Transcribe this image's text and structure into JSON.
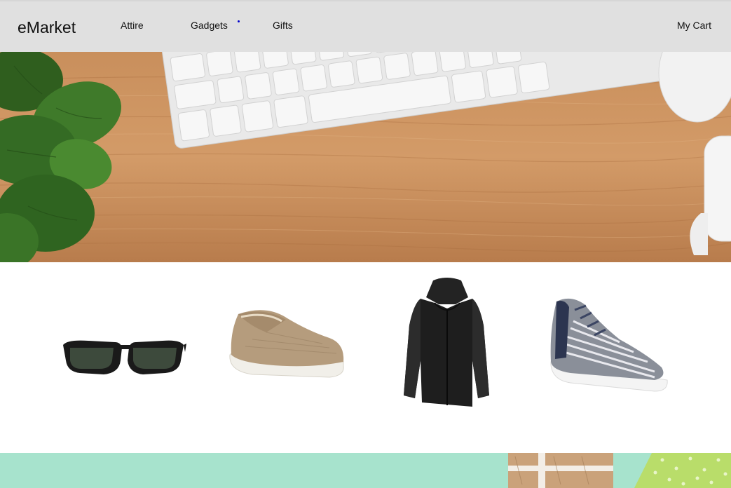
{
  "brand": {
    "name": "eMarket"
  },
  "nav": {
    "items": [
      {
        "label": "Attire"
      },
      {
        "label": "Gadgets"
      },
      {
        "label": "Gifts"
      }
    ],
    "cart_label": "My Cart"
  },
  "hero": {
    "scene": "desk-with-keyboard-plant-mouse-mug"
  },
  "products": [
    {
      "icon": "sunglasses-icon"
    },
    {
      "icon": "loafer-shoe-icon"
    },
    {
      "icon": "hooded-jacket-icon"
    },
    {
      "icon": "sneaker-icon"
    }
  ],
  "banner": {
    "scene": "gift-boxes-on-mint"
  },
  "colors": {
    "nav_bg": "#e0e0e0",
    "wood": "#c98f5c",
    "mint": "#a7e3cd"
  }
}
